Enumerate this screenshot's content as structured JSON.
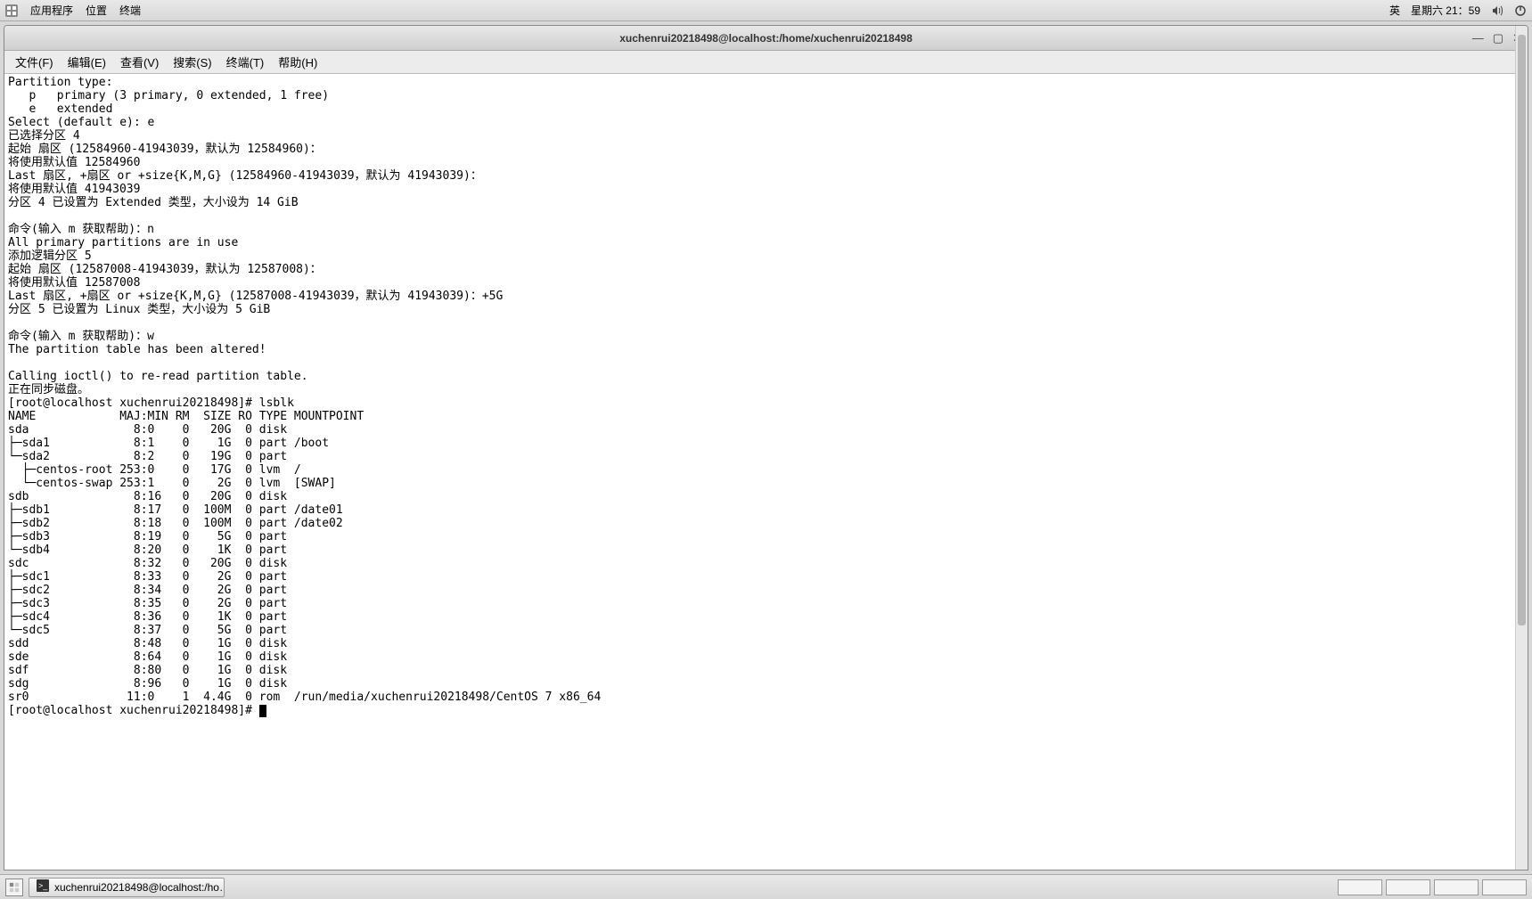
{
  "top_panel": {
    "menus": [
      "应用程序",
      "位置",
      "终端"
    ],
    "ime": "英",
    "clock": "星期六 21：59"
  },
  "window": {
    "title": "xuchenrui20218498@localhost:/home/xuchenrui20218498",
    "menubar": [
      "文件(F)",
      "编辑(E)",
      "查看(V)",
      "搜索(S)",
      "终端(T)",
      "帮助(H)"
    ]
  },
  "terminal": {
    "lines": [
      "Partition type:",
      "   p   primary (3 primary, 0 extended, 1 free)",
      "   e   extended",
      "Select (default e): e",
      "已选择分区 4",
      "起始 扇区 (12584960-41943039，默认为 12584960)：",
      "将使用默认值 12584960",
      "Last 扇区, +扇区 or +size{K,M,G} (12584960-41943039，默认为 41943039)：",
      "将使用默认值 41943039",
      "分区 4 已设置为 Extended 类型，大小设为 14 GiB",
      "",
      "命令(输入 m 获取帮助)：n",
      "All primary partitions are in use",
      "添加逻辑分区 5",
      "起始 扇区 (12587008-41943039，默认为 12587008)：",
      "将使用默认值 12587008",
      "Last 扇区, +扇区 or +size{K,M,G} (12587008-41943039，默认为 41943039)：+5G",
      "分区 5 已设置为 Linux 类型，大小设为 5 GiB",
      "",
      "命令(输入 m 获取帮助)：w",
      "The partition table has been altered!",
      "",
      "Calling ioctl() to re-read partition table.",
      "正在同步磁盘。",
      "[root@localhost xuchenrui20218498]# lsblk",
      "NAME            MAJ:MIN RM  SIZE RO TYPE MOUNTPOINT",
      "sda               8:0    0   20G  0 disk ",
      "├─sda1            8:1    0    1G  0 part /boot",
      "└─sda2            8:2    0   19G  0 part ",
      "  ├─centos-root 253:0    0   17G  0 lvm  /",
      "  └─centos-swap 253:1    0    2G  0 lvm  [SWAP]",
      "sdb               8:16   0   20G  0 disk ",
      "├─sdb1            8:17   0  100M  0 part /date01",
      "├─sdb2            8:18   0  100M  0 part /date02",
      "├─sdb3            8:19   0    5G  0 part ",
      "└─sdb4            8:20   0    1K  0 part ",
      "sdc               8:32   0   20G  0 disk ",
      "├─sdc1            8:33   0    2G  0 part ",
      "├─sdc2            8:34   0    2G  0 part ",
      "├─sdc3            8:35   0    2G  0 part ",
      "├─sdc4            8:36   0    1K  0 part ",
      "└─sdc5            8:37   0    5G  0 part ",
      "sdd               8:48   0    1G  0 disk ",
      "sde               8:64   0    1G  0 disk ",
      "sdf               8:80   0    1G  0 disk ",
      "sdg               8:96   0    1G  0 disk ",
      "sr0              11:0    1  4.4G  0 rom  /run/media/xuchenrui20218498/CentOS 7 x86_64"
    ],
    "prompt": "[root@localhost xuchenrui20218498]# "
  },
  "taskbar": {
    "task_label": "xuchenrui20218498@localhost:/ho…"
  }
}
